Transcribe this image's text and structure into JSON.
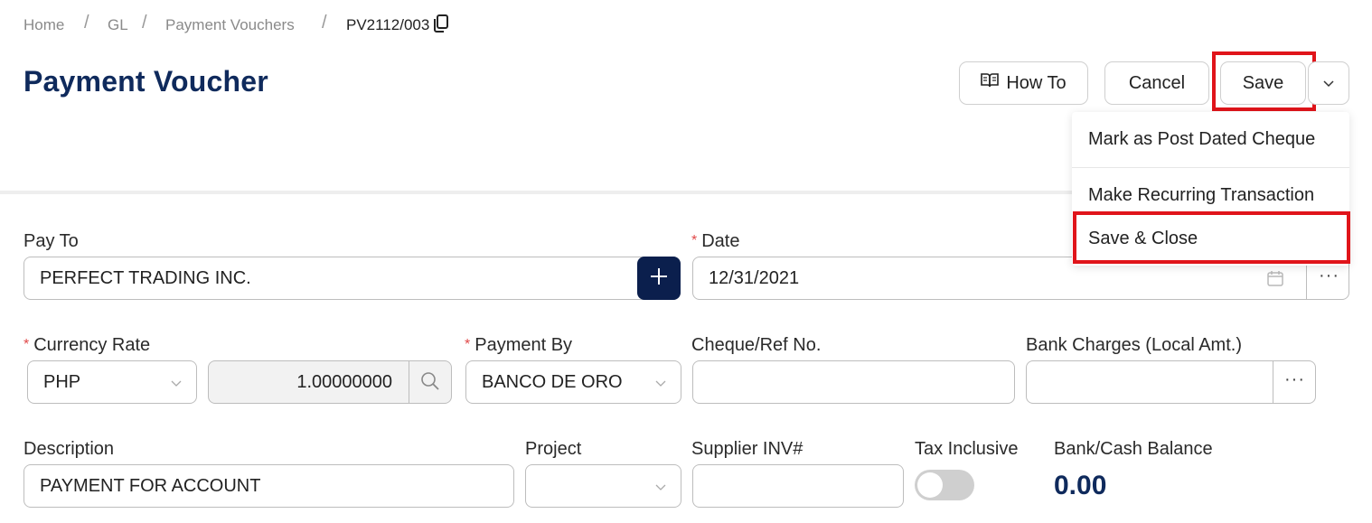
{
  "breadcrumb": {
    "items": [
      "Home",
      "GL",
      "Payment Vouchers"
    ],
    "current": "PV2112/003",
    "separator": "/"
  },
  "page": {
    "title": "Payment Voucher"
  },
  "toolbar": {
    "how_to_label": "How To",
    "cancel_label": "Cancel",
    "save_label": "Save"
  },
  "save_menu": {
    "items": [
      "Mark as Post Dated Cheque",
      "Make Recurring Transaction",
      "Save & Close"
    ]
  },
  "form": {
    "pay_to": {
      "label": "Pay To",
      "value": "PERFECT TRADING INC."
    },
    "date": {
      "label": "Date",
      "value": "12/31/2021"
    },
    "currency_rate": {
      "label": "Currency Rate",
      "currency": "PHP",
      "rate": "1.00000000"
    },
    "payment_by": {
      "label": "Payment By",
      "value": "BANCO DE ORO"
    },
    "cheque_ref": {
      "label": "Cheque/Ref No.",
      "value": ""
    },
    "bank_charges": {
      "label": "Bank Charges (Local Amt.)",
      "value": ""
    },
    "description": {
      "label": "Description",
      "value": "PAYMENT FOR ACCOUNT"
    },
    "project": {
      "label": "Project",
      "value": ""
    },
    "supplier_inv": {
      "label": "Supplier INV#",
      "value": ""
    },
    "tax_inclusive": {
      "label": "Tax Inclusive",
      "on": false
    },
    "bank_cash_balance": {
      "label": "Bank/Cash Balance",
      "value": "0.00"
    }
  },
  "colors": {
    "title": "#0f2a5c",
    "highlight": "#e0141a",
    "add_button": "#0b1f4d",
    "required": "#e04848"
  },
  "icons": [
    "copy-icon",
    "book-icon",
    "chevron-down-icon",
    "plus-icon",
    "calendar-icon",
    "more-icon",
    "search-icon"
  ]
}
